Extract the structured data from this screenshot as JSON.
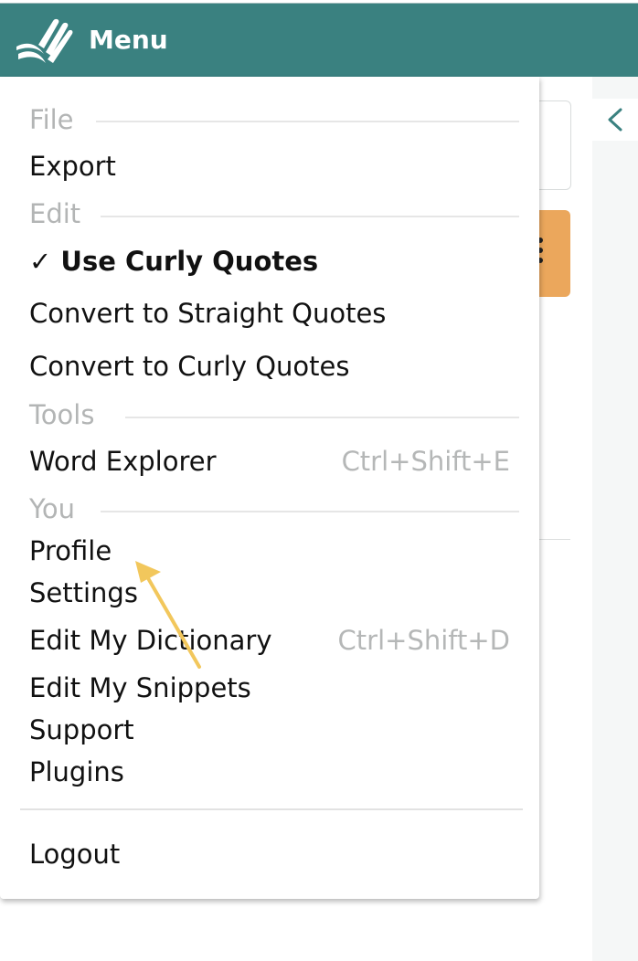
{
  "header": {
    "title": "Menu",
    "bg_color": "#3a8180",
    "logo_icon": "book-logo-icon"
  },
  "menu": {
    "sections": {
      "file": "File",
      "edit": "Edit",
      "tools": "Tools",
      "you": "You"
    },
    "items": {
      "export": "Export",
      "use_curly_quotes": "✓ Use Curly Quotes",
      "convert_straight": "Convert to Straight Quotes",
      "convert_curly": "Convert to Curly Quotes",
      "word_explorer": "Word Explorer",
      "word_explorer_shortcut": "Ctrl+Shift+E",
      "profile": "Profile",
      "settings": "Settings",
      "edit_dictionary": "Edit My Dictionary",
      "edit_dictionary_shortcut": "Ctrl+Shift+D",
      "edit_snippets": "Edit My Snippets",
      "support": "Support",
      "plugins": "Plugins",
      "logout": "Logout"
    }
  },
  "colors": {
    "accent": "#3a8180",
    "annotation_arrow": "#f2c75c",
    "background_button": "#eba75c"
  }
}
